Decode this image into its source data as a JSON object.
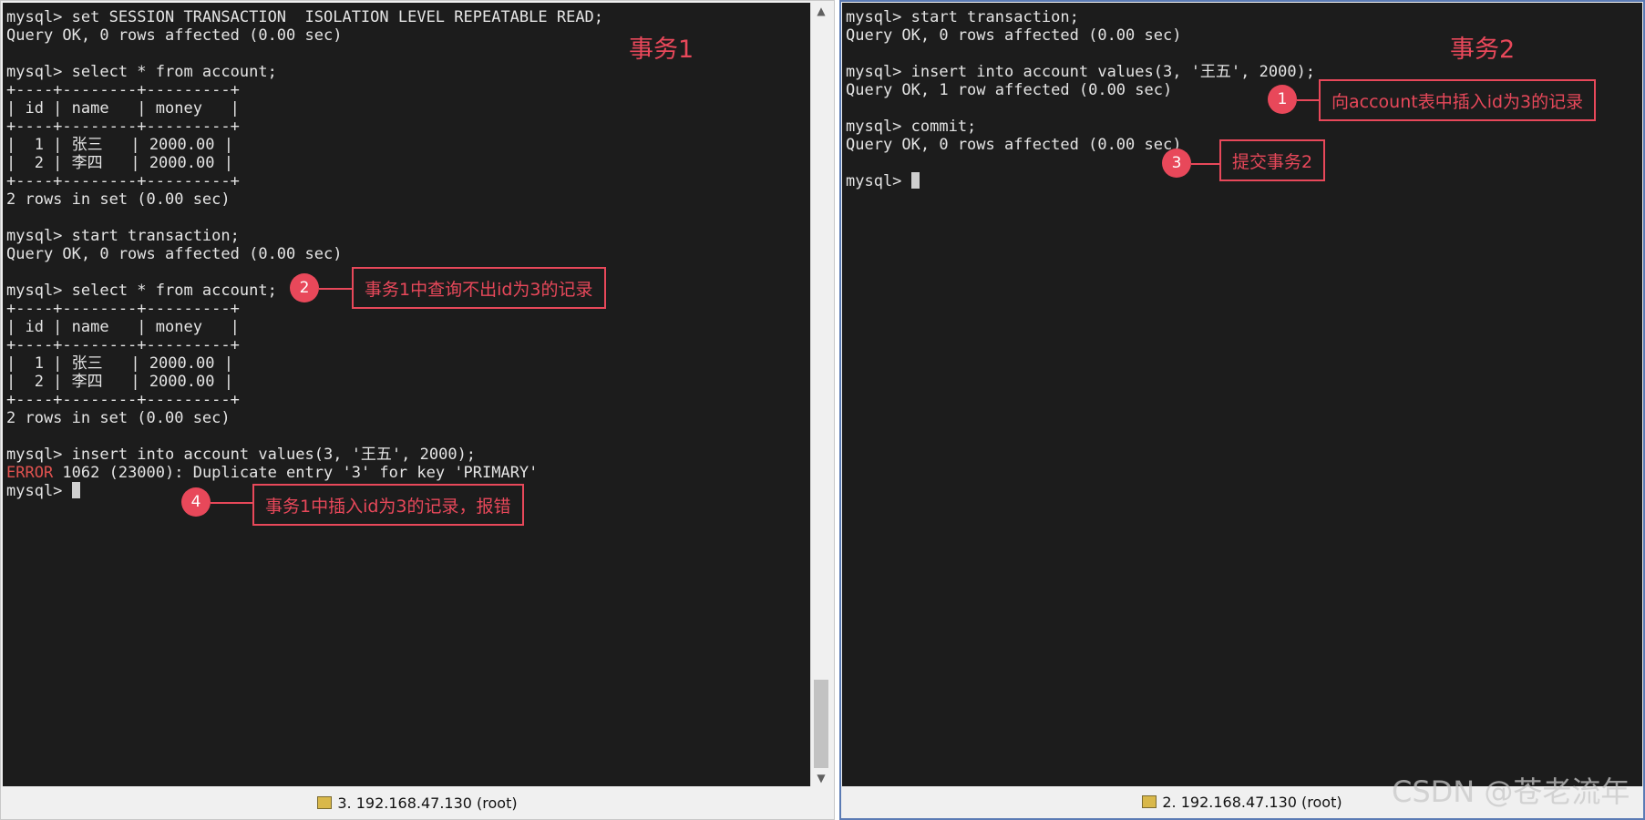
{
  "panes": {
    "left": {
      "title": "事务1",
      "status": "3. 192.168.47.130 (root)",
      "lines": [
        "mysql> set SESSION TRANSACTION  ISOLATION LEVEL REPEATABLE READ;",
        "Query OK, 0 rows affected (0.00 sec)",
        "",
        "mysql> select * from account;",
        "+----+--------+---------+",
        "| id | name   | money   |",
        "+----+--------+---------+",
        "|  1 | 张三   | 2000.00 |",
        "|  2 | 李四   | 2000.00 |",
        "+----+--------+---------+",
        "2 rows in set (0.00 sec)",
        "",
        "mysql> start transaction;",
        "Query OK, 0 rows affected (0.00 sec)",
        "",
        "mysql> select * from account;",
        "+----+--------+---------+",
        "| id | name   | money   |",
        "+----+--------+---------+",
        "|  1 | 张三   | 2000.00 |",
        "|  2 | 李四   | 2000.00 |",
        "+----+--------+---------+",
        "2 rows in set (0.00 sec)",
        "",
        "mysql> insert into account values(3, '王五', 2000);"
      ],
      "error_word": "ERROR",
      "error_rest": " 1062 (23000): Duplicate entry '3' for key 'PRIMARY'",
      "prompt": "mysql> "
    },
    "right": {
      "title": "事务2",
      "status": "2. 192.168.47.130 (root)",
      "lines": [
        "mysql> start transaction;",
        "Query OK, 0 rows affected (0.00 sec)",
        "",
        "mysql> insert into account values(3, '王五', 2000);",
        "Query OK, 1 row affected (0.00 sec)",
        "",
        "mysql> commit;",
        "Query OK, 0 rows affected (0.00 sec)",
        ""
      ],
      "prompt": "mysql> "
    }
  },
  "annotations": [
    {
      "num": "1",
      "text": "向account表中插入id为3的记录"
    },
    {
      "num": "2",
      "text": "事务1中查询不出id为3的记录"
    },
    {
      "num": "3",
      "text": "提交事务2"
    },
    {
      "num": "4",
      "text": "事务1中插入id为3的记录，报错"
    }
  ],
  "scroll_icons": {
    "up": "chevron-up-icon",
    "down": "chevron-down-icon",
    "status": "terminal-icon"
  },
  "colors": {
    "terminal_bg": "#1c1c1c",
    "text": "#e4e4e4",
    "error": "#e0524f",
    "annotation": "#e8485a",
    "active_border": "#5b7bb4"
  },
  "watermark": "CSDN @苍老流年"
}
